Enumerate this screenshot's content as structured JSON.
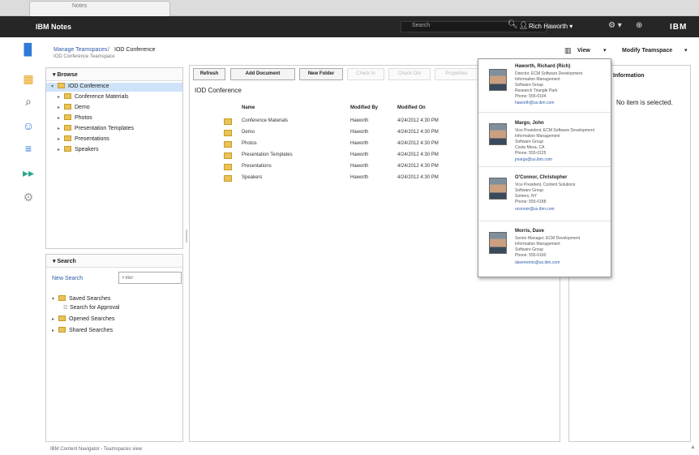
{
  "browser": {
    "tab_label": "Notes"
  },
  "topbar": {
    "brand": "IBM Notes",
    "search_placeholder": "Search",
    "user": "Rich Haworth",
    "logo": "IBM"
  },
  "nav_icons": [
    "bookmark-icon",
    "briefcase-icon",
    "search-icon",
    "people-icon",
    "filter-icon",
    "forward-icon",
    "settings-icon"
  ],
  "breadcrumb": {
    "link": "Manage Teamspaces",
    "separator": "/",
    "current": "IOD Conference",
    "subtitle": "IOD Conference Teamspace"
  },
  "browse": {
    "title": "Browse",
    "root": "IOD Conference",
    "children": [
      "Conference Materials",
      "Demo",
      "Photos",
      "Presentation Templates",
      "Presentations",
      "Speakers"
    ]
  },
  "search_panel": {
    "title": "Search",
    "new_search": "New Search",
    "filter_placeholder": "Filter",
    "items": [
      "Saved Searches",
      "Search for Approval",
      "Opened Searches",
      "Shared Searches"
    ]
  },
  "toolbar": {
    "refresh": "Refresh",
    "add_document": "Add Document",
    "new_folder": "New Folder",
    "check_in": "Check In",
    "check_out": "Check Out",
    "properties": "Properties"
  },
  "main": {
    "title": "IOD Conference",
    "columns": [
      "Name",
      "Modified By",
      "Modified On"
    ],
    "rows": [
      {
        "name": "Conference Materials",
        "by": "Haworth",
        "on": "4/24/2012 4:30 PM"
      },
      {
        "name": "Demo",
        "by": "Haworth",
        "on": "4/24/2012 4:30 PM"
      },
      {
        "name": "Photos",
        "by": "Haworth",
        "on": "4/24/2012 4:30 PM"
      },
      {
        "name": "Presentation Templates",
        "by": "Haworth",
        "on": "4/24/2012 4:30 PM"
      },
      {
        "name": "Presentations",
        "by": "Haworth",
        "on": "4/24/2012 4:30 PM"
      },
      {
        "name": "Speakers",
        "by": "Haworth",
        "on": "4/24/2012 4:30 PM"
      }
    ]
  },
  "view": {
    "label": "View",
    "modify": "Modify Teamspace"
  },
  "info": {
    "title": "Information",
    "message": "No item is selected."
  },
  "people": [
    {
      "name": "Haworth, Richard (Rich)",
      "lines": [
        "Director, ECM Software Development",
        "Information Management",
        "Software Group",
        "Research Triangle Park",
        "Phone: 555-0104"
      ],
      "email": "haworth@us.ibm.com"
    },
    {
      "name": "Margo, John",
      "lines": [
        "Vice President, ECM Software Development",
        "Information Management",
        "Software Group",
        "Costa Mesa, CA",
        "Phone: 555-0125"
      ],
      "email": "jmargo@us.ibm.com"
    },
    {
      "name": "O'Connor, Christopher",
      "lines": [
        "Vice President, Content Solutions",
        "Software Group",
        "Somers, NY",
        "Phone: 555-0188"
      ],
      "email": "oconnor@us.ibm.com"
    },
    {
      "name": "Morris, Dave",
      "lines": [
        "Senior Manager, ECM Development",
        "Information Management",
        "Software Group",
        "Phone: 555-0160"
      ],
      "email": "davemorris@us.ibm.com"
    }
  ],
  "status": "IBM Content Navigator - Teamspaces view"
}
